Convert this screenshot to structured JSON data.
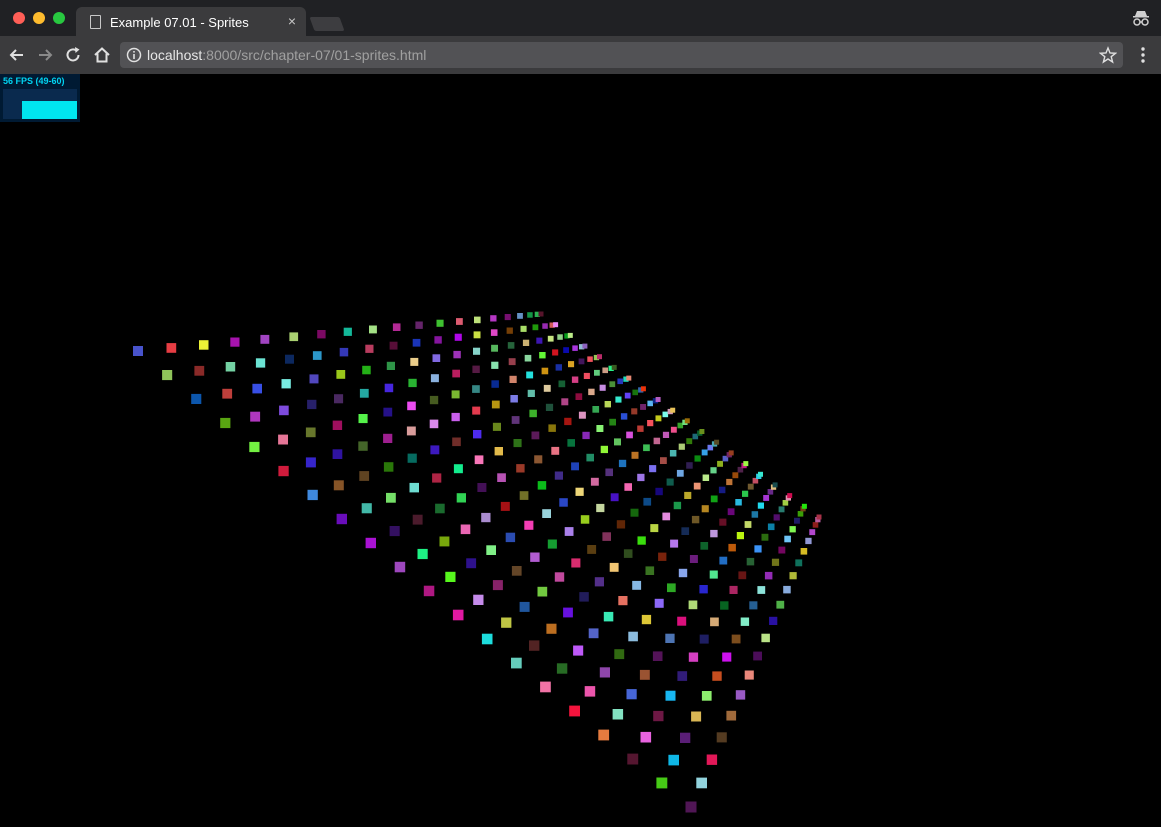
{
  "window": {
    "traffic_lights": [
      "#ff5f57",
      "#febc2e",
      "#28c840"
    ]
  },
  "tab": {
    "title": "Example 07.01 - Sprites",
    "close_glyph": "×"
  },
  "toolbar": {
    "back_icon": "back-arrow-icon",
    "forward_icon": "forward-arrow-icon",
    "reload_icon": "reload-icon",
    "home_icon": "home-icon"
  },
  "address": {
    "host": "localhost",
    "path": ":8000/src/chapter-07/01-sprites.html"
  },
  "stats": {
    "fps_text": "56 FPS (49-60)",
    "fps_fill": 0.6
  },
  "scene": {
    "background": "#000000",
    "grid_rows": 20,
    "grid_cols": 20
  }
}
